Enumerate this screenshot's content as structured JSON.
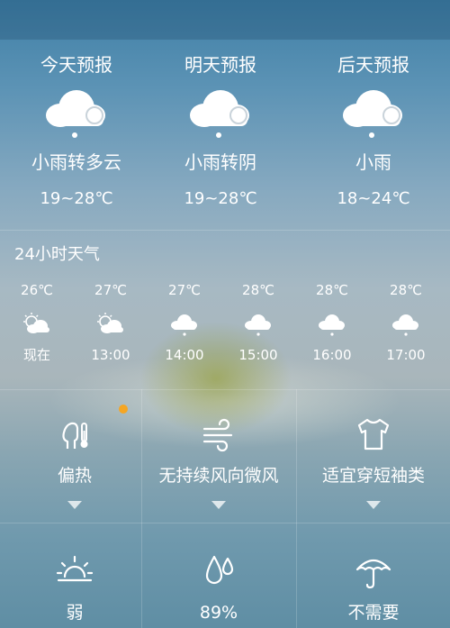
{
  "forecast": [
    {
      "title": "今天预报",
      "condition": "小雨转多云",
      "temp": "19~28℃",
      "icon": "cloud-rain-icon"
    },
    {
      "title": "明天预报",
      "condition": "小雨转阴",
      "temp": "19~28℃",
      "icon": "cloud-rain-icon"
    },
    {
      "title": "后天预报",
      "condition": "小雨",
      "temp": "18~24℃",
      "icon": "cloud-rain-icon"
    }
  ],
  "hourly_title": "24小时天气",
  "hourly": [
    {
      "temp": "26℃",
      "time": "现在",
      "icon": "sun-cloud-icon"
    },
    {
      "temp": "27℃",
      "time": "13:00",
      "icon": "sun-cloud-icon"
    },
    {
      "temp": "27℃",
      "time": "14:00",
      "icon": "cloud-rain-icon"
    },
    {
      "temp": "28℃",
      "time": "15:00",
      "icon": "cloud-rain-icon"
    },
    {
      "temp": "28℃",
      "time": "16:00",
      "icon": "cloud-rain-icon"
    },
    {
      "temp": "28℃",
      "time": "17:00",
      "icon": "cloud-rain-icon"
    }
  ],
  "tiles": [
    {
      "label": "偏热",
      "icon": "body-temperature-icon"
    },
    {
      "label": "无持续风向微风",
      "icon": "wind-icon"
    },
    {
      "label": "适宜穿短袖类",
      "icon": "tshirt-icon"
    },
    {
      "label": "弱",
      "icon": "uv-sunrise-icon"
    },
    {
      "label": "89%",
      "icon": "humidity-drops-icon"
    },
    {
      "label": "不需要",
      "icon": "umbrella-icon"
    }
  ],
  "colors": {
    "notification_dot": "#f5a623"
  }
}
